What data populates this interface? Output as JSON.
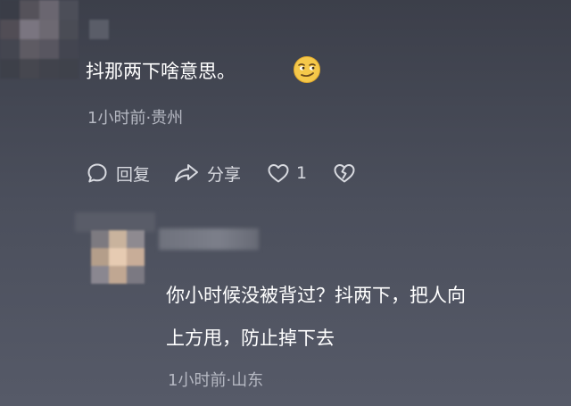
{
  "comment1": {
    "text": "抖那两下啥意思。",
    "meta": "1小时前·贵州",
    "emoji_icon": "smirk-emoji-icon",
    "actions": {
      "reply_label": "回复",
      "share_label": "分享",
      "like_count": "1"
    }
  },
  "comment2": {
    "line1": "你小时候没被背过？抖两下，把人向",
    "line2": "上方甩，防止掉下去",
    "meta": "1小时前·山东"
  }
}
